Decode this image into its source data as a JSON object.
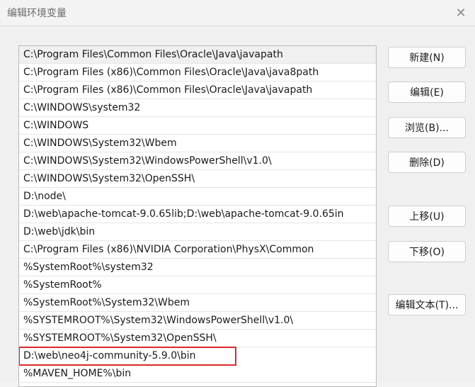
{
  "window": {
    "title": "编辑环境变量",
    "close_glyph": "✕"
  },
  "paths": [
    "C:\\Program Files\\Common Files\\Oracle\\Java\\javapath",
    "C:\\Program Files (x86)\\Common Files\\Oracle\\Java\\java8path",
    "C:\\Program Files (x86)\\Common Files\\Oracle\\Java\\javapath",
    "C:\\WINDOWS\\system32",
    "C:\\WINDOWS",
    "C:\\WINDOWS\\System32\\Wbem",
    "C:\\WINDOWS\\System32\\WindowsPowerShell\\v1.0\\",
    "C:\\WINDOWS\\System32\\OpenSSH\\",
    "D:\\node\\",
    "D:\\web\\apache-tomcat-9.0.65lib;D:\\web\\apache-tomcat-9.0.65in",
    "D:\\web\\jdk\\bin",
    "C:\\Program Files (x86)\\NVIDIA Corporation\\PhysX\\Common",
    "%SystemRoot%\\system32",
    "%SystemRoot%",
    "%SystemRoot%\\System32\\Wbem",
    "%SYSTEMROOT%\\System32\\WindowsPowerShell\\v1.0\\",
    "%SYSTEMROOT%\\System32\\OpenSSH\\",
    "D:\\web\\neo4j-community-5.9.0\\bin",
    "%MAVEN_HOME%\\bin"
  ],
  "buttons": {
    "new": "新建(N)",
    "edit": "编辑(E)",
    "browse": "浏览(B)...",
    "delete": "删除(D)",
    "move_up": "上移(U)",
    "move_down": "下移(O)",
    "edit_text": "编辑文本(T)..."
  },
  "colors": {
    "highlight_border": "#d92a2a",
    "selected_row_bg": "#f0f0f0"
  }
}
